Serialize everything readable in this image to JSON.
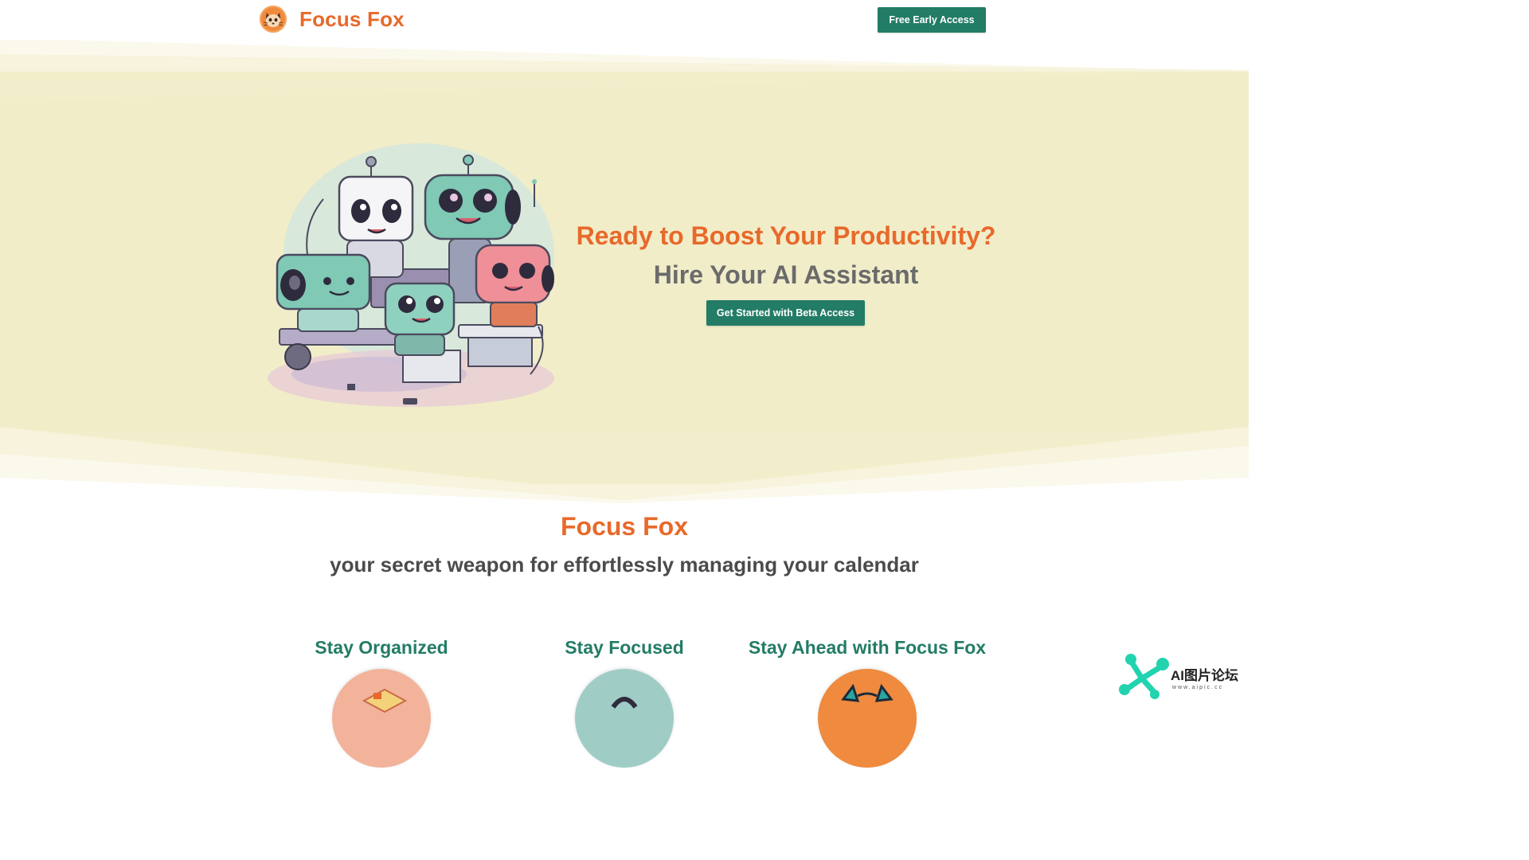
{
  "header": {
    "brand_name": "Focus Fox",
    "cta_label": "Free Early Access"
  },
  "hero": {
    "title": "Ready to Boost Your Productivity?",
    "subtitle": "Hire Your AI Assistant",
    "cta_label": "Get Started with Beta Access"
  },
  "intro": {
    "title": "Focus Fox",
    "subtitle": "your secret weapon for effortlessly managing your calendar"
  },
  "features": [
    {
      "title": "Stay Organized"
    },
    {
      "title": "Stay Focused"
    },
    {
      "title": "Stay Ahead with Focus Fox"
    }
  ],
  "watermark": {
    "text": "AI图片论坛",
    "url": "www.aipic.cc"
  },
  "colors": {
    "brand_orange": "#e8692a",
    "button_green": "#237c66",
    "hero_background": "#f2eecb",
    "heading_gray": "#6b6b6b"
  }
}
